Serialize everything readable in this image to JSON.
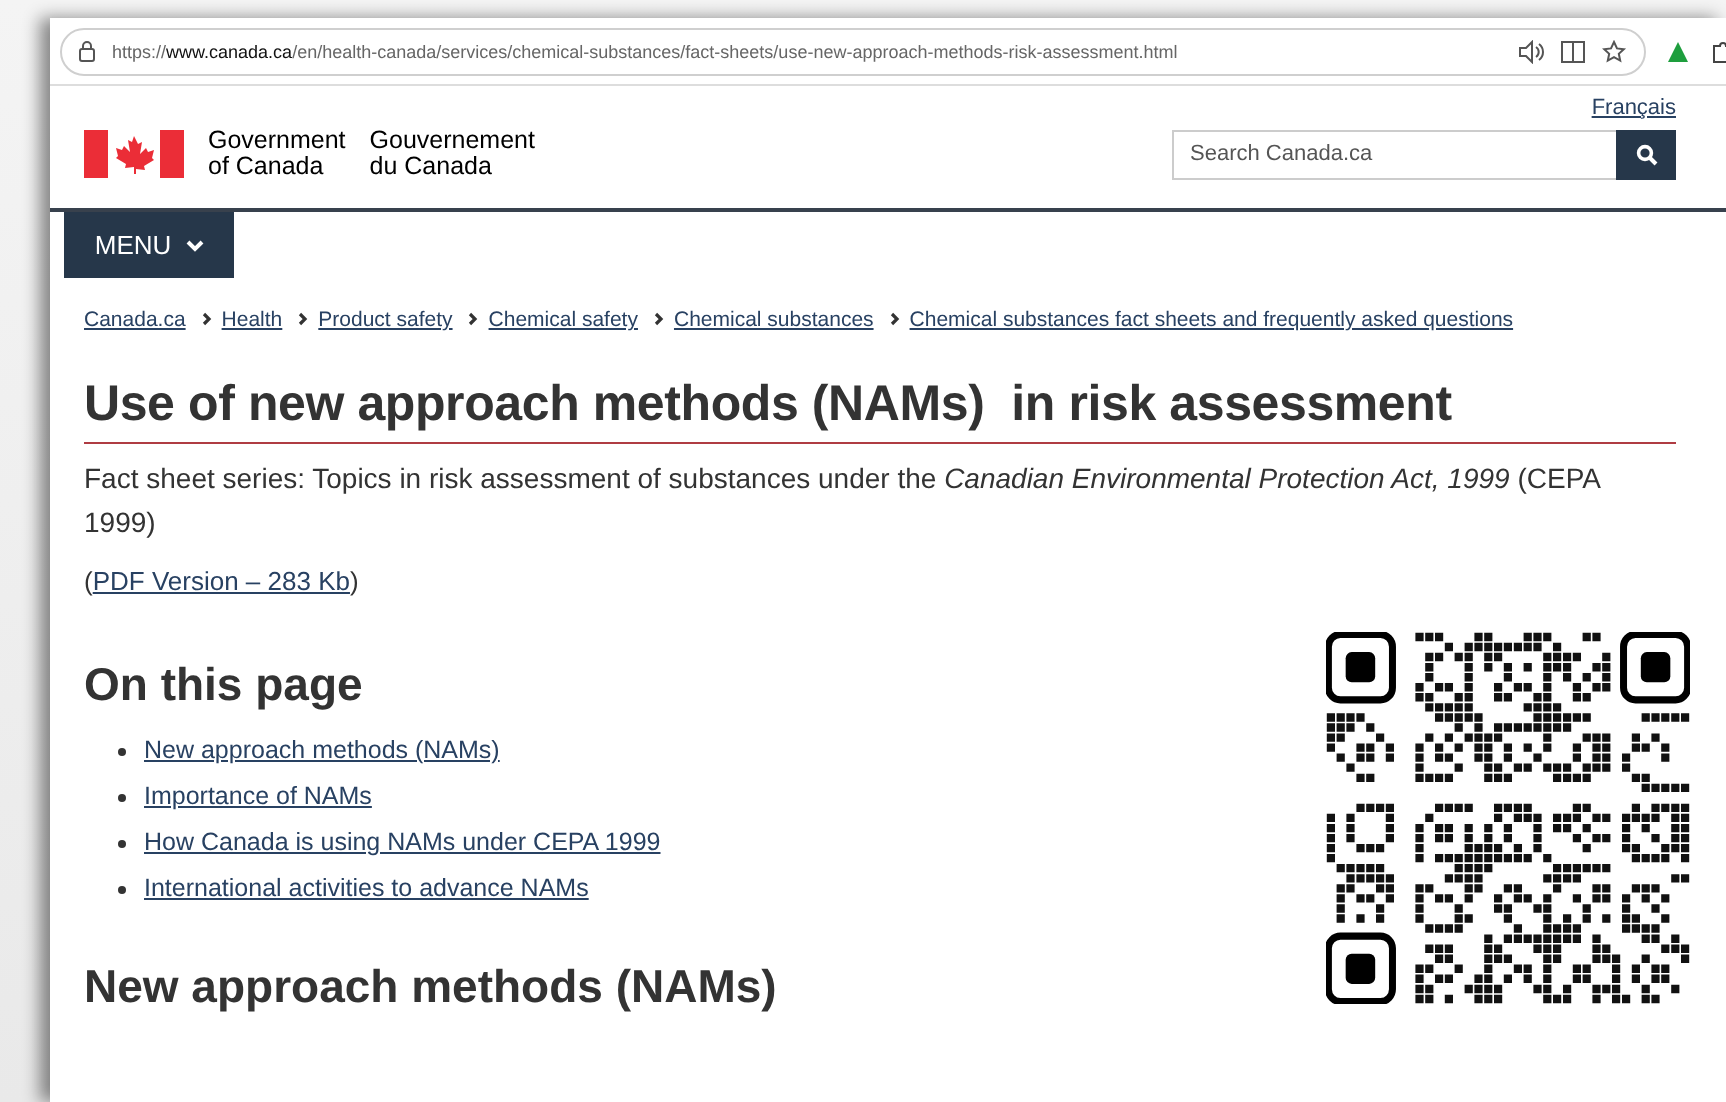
{
  "browser": {
    "url": "https://**www.canada.ca**/en/health-canada/services/chemical-substances/fact-sheets/use-new-approach-methods-risk-assessment.html"
  },
  "header": {
    "language_link": "Français",
    "signature_en": "Government\nof Canada",
    "signature_fr": "Gouvernement\ndu Canada",
    "search": {
      "placeholder": "Search Canada.ca"
    },
    "menu": "MENU"
  },
  "breadcrumbs": [
    "Canada.ca",
    "Health",
    "Product safety",
    "Chemical safety",
    "Chemical substances",
    "Chemical substances fact sheets and frequently asked questions"
  ],
  "title": "Use of new approach methods (NAMs)  in risk assessment",
  "intro": "Fact sheet series: Topics in risk assessment of substances under the *Canadian Environmental Protection Act, 1999* (CEPA 1999)",
  "pdf": {
    "before": "(",
    "link": "PDF Version – 283 Kb",
    "after": ")"
  },
  "toc": {
    "heading": "On this page",
    "items": [
      "New approach methods (NAMs)",
      "Importance of NAMs",
      "How Canada is using NAMs under CEPA 1999",
      "International activities to advance NAMs"
    ]
  },
  "section_heading": "New approach methods (NAMs)"
}
